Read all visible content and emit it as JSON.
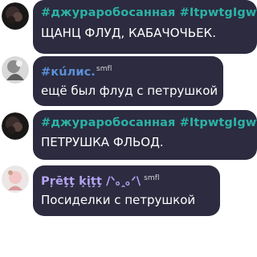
{
  "messages": [
    {
      "author": "#джураробосанная #ItpwtgIgwtb",
      "tag": "",
      "text": "ЩАНЦ ФЛУД, КАБАЧОЧЬЕК.",
      "name_color": "#2bb3a6",
      "avatar": "dark-avatar"
    },
    {
      "author": "#кúлис.",
      "tag": "smfl",
      "text": "ещё был флуд с петрушкой",
      "name_color": "#5a8fd6",
      "avatar": "gray-avatar"
    },
    {
      "author": "#джураробосанная #ItpwtgIgwtb",
      "tag": "",
      "text": "ПЕТРУШКА ФЛЬОД.",
      "name_color": "#2bb3a6",
      "avatar": "dark-avatar"
    },
    {
      "author": "Pŗēţţ ķįţţ /ᐠ｡ꞈ｡ᐟ\\",
      "tag": "smfl",
      "text": "Посиделки с петрушкой",
      "name_color": "#b3a3f0",
      "avatar": "pink-avatar"
    }
  ]
}
